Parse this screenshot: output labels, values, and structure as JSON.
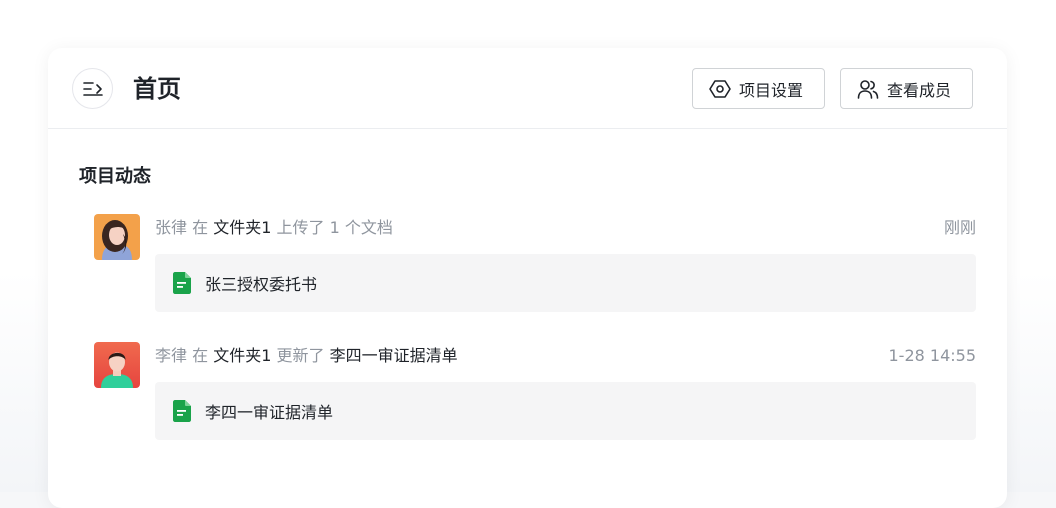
{
  "header": {
    "title": "首页",
    "settings_label": "项目设置",
    "members_label": "查看成员"
  },
  "section": {
    "title": "项目动态"
  },
  "activities": [
    {
      "user": "张律",
      "in": "在",
      "folder": "文件夹1",
      "action": "上传了 1 个文档",
      "target": "",
      "time": "刚刚",
      "file": "张三授权委托书",
      "file_icon": "doc-icon",
      "avatar": "avatar-female"
    },
    {
      "user": "李律",
      "in": "在",
      "folder": "文件夹1",
      "action": "更新了",
      "target": "李四一审证据清单",
      "time": "1-28 14:55",
      "file": "李四一审证据清单",
      "file_icon": "doc-icon",
      "avatar": "avatar-male"
    }
  ],
  "colors": {
    "doc_icon": "#1aa34a",
    "muted_text": "#8f959e",
    "primary_text": "#1f2329",
    "file_bg": "#f5f5f6"
  }
}
